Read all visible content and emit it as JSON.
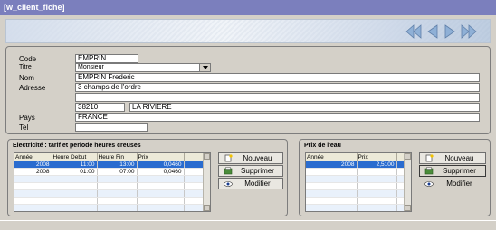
{
  "window": {
    "title": "[w_client_fiche]"
  },
  "nav": {
    "icons": [
      "first-icon",
      "previous-icon",
      "next-icon",
      "last-icon"
    ]
  },
  "client": {
    "labels": {
      "code": "Code",
      "titre": "Titre",
      "nom": "Nom",
      "adresse": "Adresse",
      "pays": "Pays",
      "tel": "Tel"
    },
    "code": "EMPRIN",
    "titre": "Monsieur",
    "nom": "EMPRIN Frederic",
    "adresse1": "3 champs de l'ordre",
    "adresse2": "",
    "cp": "38210",
    "ville": "LA RIVIERE",
    "pays": "FRANCE",
    "tel": ""
  },
  "electricite": {
    "title": "Electricité : tarif et periode heures creuses",
    "columns": [
      "Année",
      "Heure Debut",
      "Heure Fin",
      "Prix"
    ],
    "rows": [
      [
        "2008",
        "11:00",
        "13:00",
        "0,0460"
      ],
      [
        "2008",
        "01:00",
        "07:00",
        "0,0460"
      ]
    ],
    "buttons": {
      "nouveau": "Nouveau",
      "supprimer": "Supprimer",
      "modifier": "Modifier"
    }
  },
  "eau": {
    "title": "Prix de l'eau",
    "columns": [
      "Année",
      "Prix"
    ],
    "rows": [
      [
        "2008",
        "2,5100"
      ]
    ],
    "buttons": {
      "nouveau": "Nouveau",
      "supprimer": "Supprimer",
      "modifier": "Modifier"
    }
  },
  "colors": {
    "title_bar": "#7b7fbd",
    "selection": "#2a6ccf",
    "nav_arrow": "#6f8fb5"
  }
}
